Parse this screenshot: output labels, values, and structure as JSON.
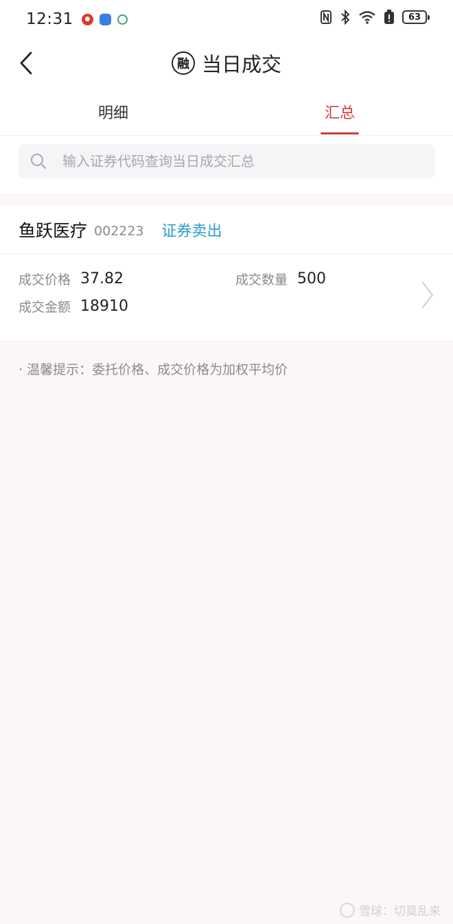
{
  "status_bar": {
    "time": "12:31",
    "battery": "63",
    "app_icons": [
      "weibo-app-icon",
      "cloud-app-icon",
      "ring-app-icon"
    ],
    "system_icons": [
      "nfc-icon",
      "bluetooth-icon",
      "wifi-icon",
      "battery-saver-icon",
      "battery-icon"
    ]
  },
  "header": {
    "title": "当日成交",
    "logo_glyph": "融"
  },
  "tabs": [
    {
      "label": "明细",
      "active": false
    },
    {
      "label": "汇总",
      "active": true
    }
  ],
  "search": {
    "placeholder": "输入证券代码查询当日成交汇总",
    "value": ""
  },
  "trade": {
    "name": "鱼跃医疗",
    "code": "002223",
    "type": "证券卖出",
    "price_label": "成交价格",
    "price": "37.82",
    "qty_label": "成交数量",
    "qty": "500",
    "amount_label": "成交金额",
    "amount": "18910"
  },
  "tip": "· 温馨提示：委托价格、成交价格为加权平均价",
  "watermark": "雪球：切莫乱来",
  "colors": {
    "accent_red": "#d03c3c",
    "trade_type_blue": "#2b9bc9",
    "page_bg": "#fcf6fb"
  }
}
